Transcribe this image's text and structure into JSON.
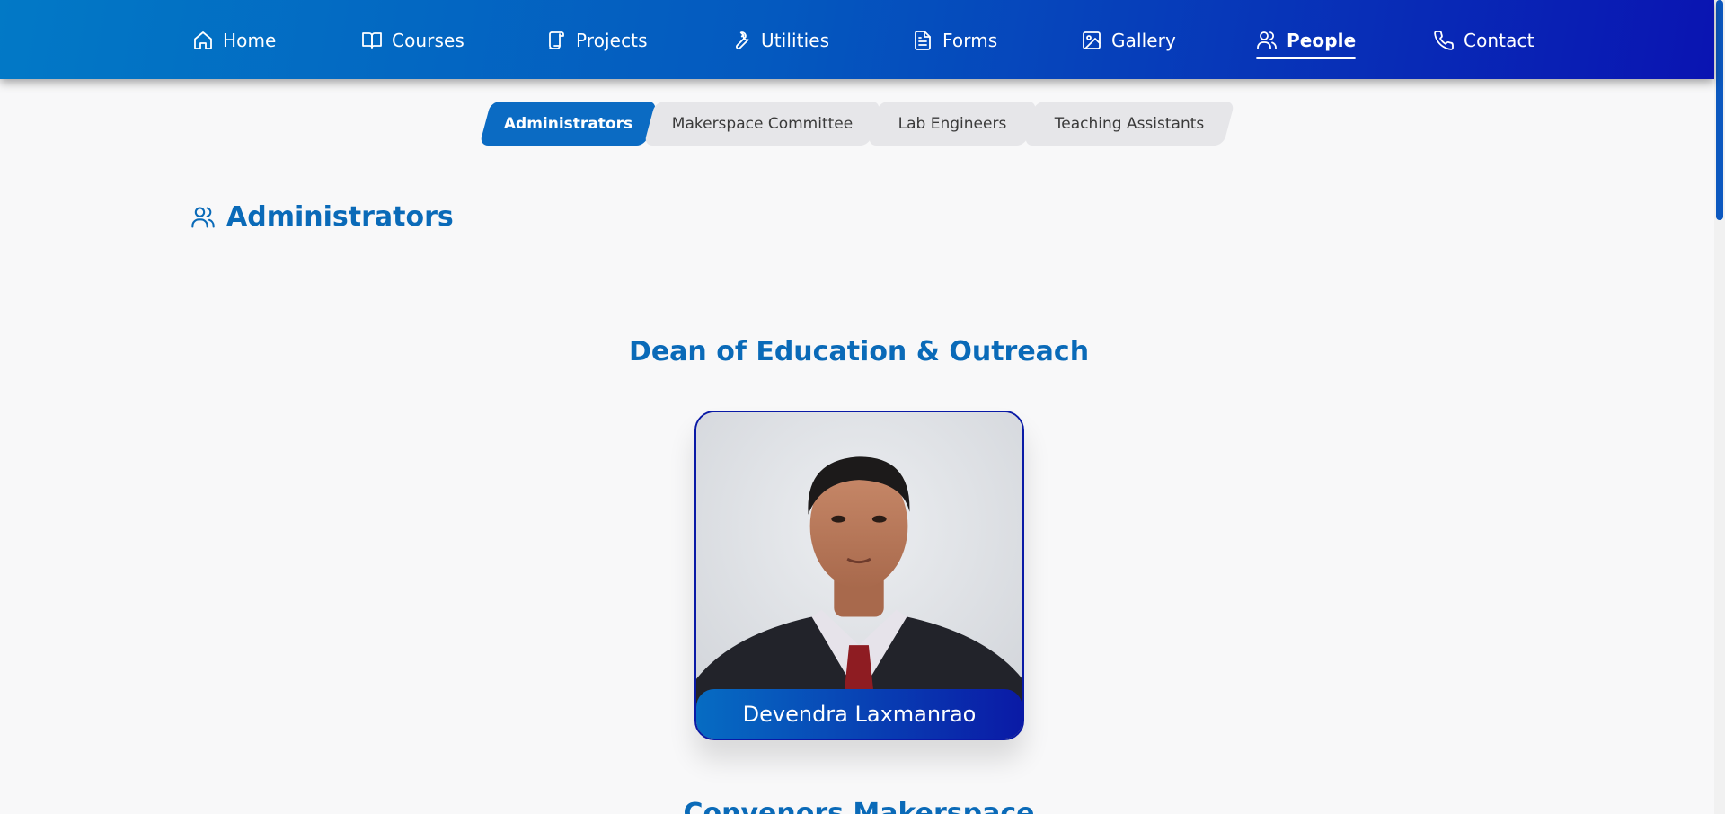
{
  "nav": {
    "items": [
      {
        "label": "Home",
        "icon": "home-icon"
      },
      {
        "label": "Courses",
        "icon": "book-icon"
      },
      {
        "label": "Projects",
        "icon": "scroll-icon"
      },
      {
        "label": "Utilities",
        "icon": "wrench-icon"
      },
      {
        "label": "Forms",
        "icon": "document-icon"
      },
      {
        "label": "Gallery",
        "icon": "image-icon"
      },
      {
        "label": "People",
        "icon": "users-icon",
        "active": true
      },
      {
        "label": "Contact",
        "icon": "phone-icon"
      }
    ]
  },
  "tabs": [
    {
      "label": "Administrators",
      "active": true
    },
    {
      "label": "Makerspace Committee"
    },
    {
      "label": "Lab Engineers"
    },
    {
      "label": "Teaching Assistants"
    }
  ],
  "section": {
    "title": "Administrators",
    "icon": "users-icon"
  },
  "roles": [
    {
      "title": "Dean of Education & Outreach",
      "person": {
        "name": "Devendra Laxmanrao"
      }
    },
    {
      "title": "Convenors Makerspace"
    }
  ],
  "colors": {
    "nav_start": "#0279c6",
    "nav_end": "#0a14b2",
    "accent": "#0a6ab8",
    "tab_active": "#0b6bc3"
  }
}
